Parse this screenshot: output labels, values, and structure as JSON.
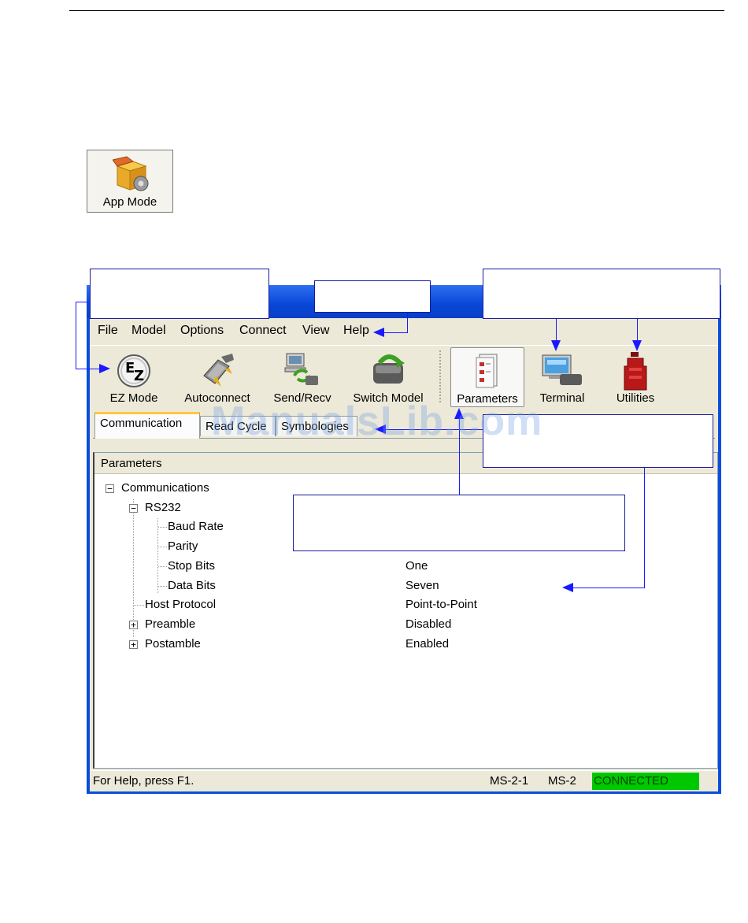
{
  "app_mode_button": {
    "label": "App Mode",
    "icon": "app-mode-box-gear-icon"
  },
  "menu": [
    "File",
    "Model",
    "Options",
    "Connect",
    "View",
    "Help"
  ],
  "toolbar": [
    {
      "label": "EZ Mode",
      "icon": "ez-mode-icon"
    },
    {
      "label": "Autoconnect",
      "icon": "autoconnect-plug-icon"
    },
    {
      "label": "Send/Recv",
      "icon": "send-recv-icon"
    },
    {
      "label": "Switch Model",
      "icon": "switch-model-icon"
    },
    {
      "label": "Parameters",
      "icon": "parameters-doc-icon"
    },
    {
      "label": "Terminal",
      "icon": "terminal-monitor-icon"
    },
    {
      "label": "Utilities",
      "icon": "utilities-toolbox-icon"
    }
  ],
  "tabs": [
    "Communication",
    "Read Cycle",
    "Symbologies"
  ],
  "panel": {
    "header": "Parameters"
  },
  "tree": [
    {
      "label": "Communications",
      "value": ""
    },
    {
      "label": "RS232",
      "value": ""
    },
    {
      "label": "Baud Rate",
      "value": ""
    },
    {
      "label": "Parity",
      "value": ""
    },
    {
      "label": "Stop Bits",
      "value": "One"
    },
    {
      "label": "Data Bits",
      "value": "Seven"
    },
    {
      "label": "Host Protocol",
      "value": "Point-to-Point"
    },
    {
      "label": "Preamble",
      "value": "Disabled"
    },
    {
      "label": "Postamble",
      "value": "Enabled"
    }
  ],
  "status": {
    "help": "For Help, press F1.",
    "model1": "MS-2-1",
    "model2": "MS-2",
    "connection": "CONNECTED",
    "connection_color": "#00c800"
  },
  "watermark": "ManualsLib.com"
}
